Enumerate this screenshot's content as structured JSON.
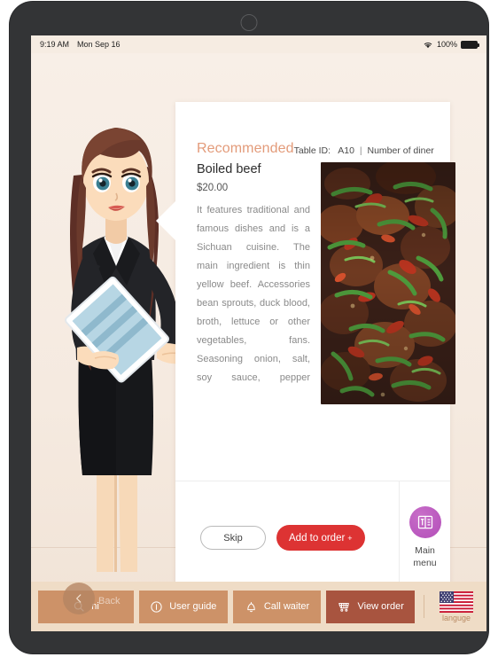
{
  "status_bar": {
    "time": "9:19 AM",
    "date": "Mon Sep 16",
    "battery_percent": "100%",
    "wifi_icon": "wifi-icon",
    "battery_icon": "battery-icon"
  },
  "card": {
    "section_title": "Recommended",
    "table_label": "Table ID:",
    "table_id": "A10",
    "separator": "|",
    "diners_label": "Number of diner",
    "dish": {
      "name": "Boiled beef",
      "price": "$20.00",
      "description": "It features traditional and famous dishes and is a Sichuan cuisine. The main ingredient is thin yellow beef. Accessories bean sprouts, duck blood, broth, lettuce or other vegetables, fans. Seasoning onion, salt, soy sauce, pepper",
      "photo_alt": "boiled-beef-photo"
    },
    "actions": {
      "skip_label": "Skip",
      "add_label": "Add to order",
      "add_plus": "+"
    },
    "main_menu": {
      "label_line1": "Main",
      "label_line2": "menu",
      "icon": "menu-book-icon"
    }
  },
  "bottom_nav": {
    "items": [
      {
        "label": "ni",
        "icon": "search-icon",
        "active": false
      },
      {
        "label": "User guide",
        "icon": "info-circle-icon",
        "active": false
      },
      {
        "label": "Call waiter",
        "icon": "bell-icon",
        "active": false
      },
      {
        "label": "View order",
        "icon": "cart-icon",
        "active": true
      }
    ],
    "back_button": {
      "label": "Back",
      "icon": "chevron-left-icon"
    },
    "language": {
      "label": "languge",
      "icon": "us-flag-icon"
    }
  },
  "avatar": {
    "name": "waitress-illustration"
  },
  "colors": {
    "accent_salmon": "#e39b7a",
    "add_button_red": "#dd3333",
    "nav_brown": "#cd9268",
    "nav_active_brown": "#a8543f",
    "nav_bar_bg": "#efdcc6",
    "main_menu_purple": "#bc5cc0",
    "app_bg": "#f6ece2"
  }
}
